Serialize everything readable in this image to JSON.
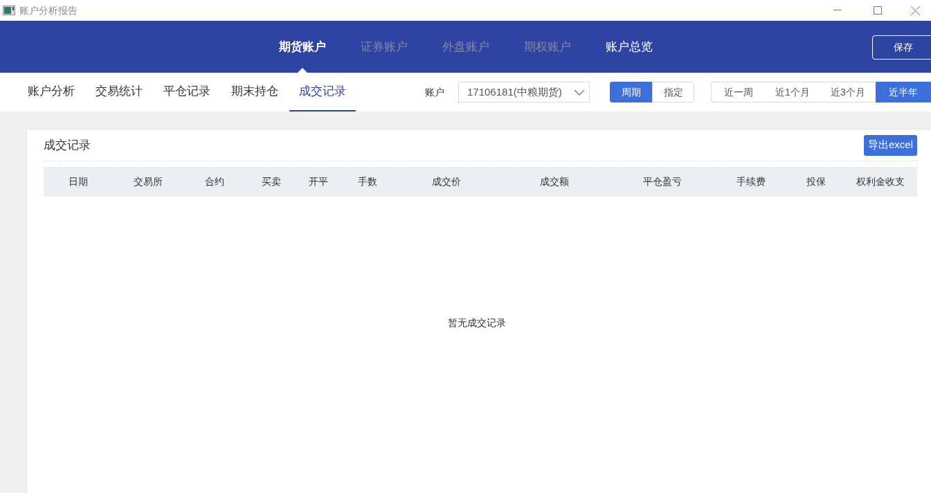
{
  "window": {
    "title": "账户分析报告"
  },
  "account_tabs": [
    {
      "label": "期货账户",
      "selected": true,
      "disabled": false
    },
    {
      "label": "证券账户",
      "selected": false,
      "disabled": true
    },
    {
      "label": "外盘账户",
      "selected": false,
      "disabled": true
    },
    {
      "label": "期权账户",
      "selected": false,
      "disabled": true
    },
    {
      "label": "账户总览",
      "selected": false,
      "disabled": false
    }
  ],
  "save_button": "保存",
  "report_tabs": [
    {
      "label": "账户分析",
      "selected": false
    },
    {
      "label": "交易统计",
      "selected": false
    },
    {
      "label": "平仓记录",
      "selected": false
    },
    {
      "label": "期末持仓",
      "selected": false
    },
    {
      "label": "成交记录",
      "selected": true
    }
  ],
  "account_label": "账户",
  "account_select": "17106181(中粮期货)",
  "period_mode": [
    {
      "label": "周期",
      "selected": true
    },
    {
      "label": "指定",
      "selected": false
    }
  ],
  "ranges": [
    {
      "label": "近一周",
      "selected": false
    },
    {
      "label": "近1个月",
      "selected": false
    },
    {
      "label": "近3个月",
      "selected": false
    },
    {
      "label": "近半年",
      "selected": true
    }
  ],
  "panel": {
    "title": "成交记录",
    "export_button": "导出excel",
    "table": {
      "columns": [
        "日期",
        "交易所",
        "合约",
        "买卖",
        "开平",
        "手数",
        "成交价",
        "成交额",
        "平仓盈亏",
        "手续费",
        "投保",
        "权利金收支"
      ],
      "empty_text": "暂无成交记录"
    }
  }
}
